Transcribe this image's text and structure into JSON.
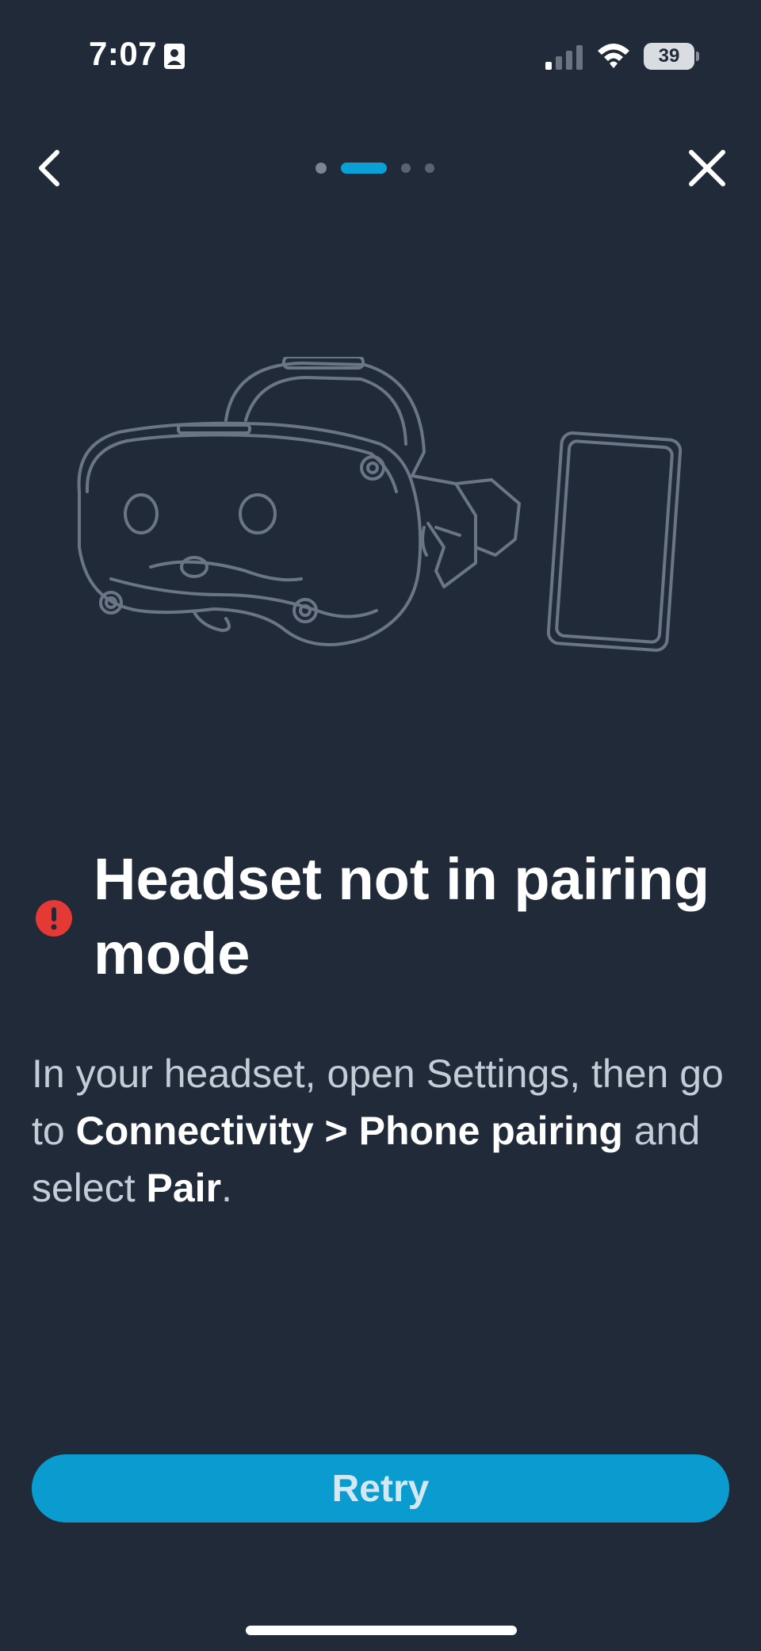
{
  "status_bar": {
    "time": "7:07",
    "battery": "39"
  },
  "header": {
    "back_icon": "chevron-left-icon",
    "close_icon": "close-icon",
    "progress": {
      "total_steps": 4,
      "current_step": 2
    }
  },
  "illustration": {
    "icon": "headset-and-phone-illustration"
  },
  "main": {
    "error_icon": "exclamation-circle-icon",
    "title": "Headset not in pairing mode",
    "body_part1": "In your headset, open Settings, then go to ",
    "body_bold1": "Connectivity > Phone pairing",
    "body_part2": " and select ",
    "body_bold2": "Pair",
    "body_part3": "."
  },
  "actions": {
    "retry_label": "Retry"
  },
  "colors": {
    "background": "#212a38",
    "accent": "#0a9ccf",
    "error": "#e53935",
    "illustration_stroke": "#6a7586"
  }
}
